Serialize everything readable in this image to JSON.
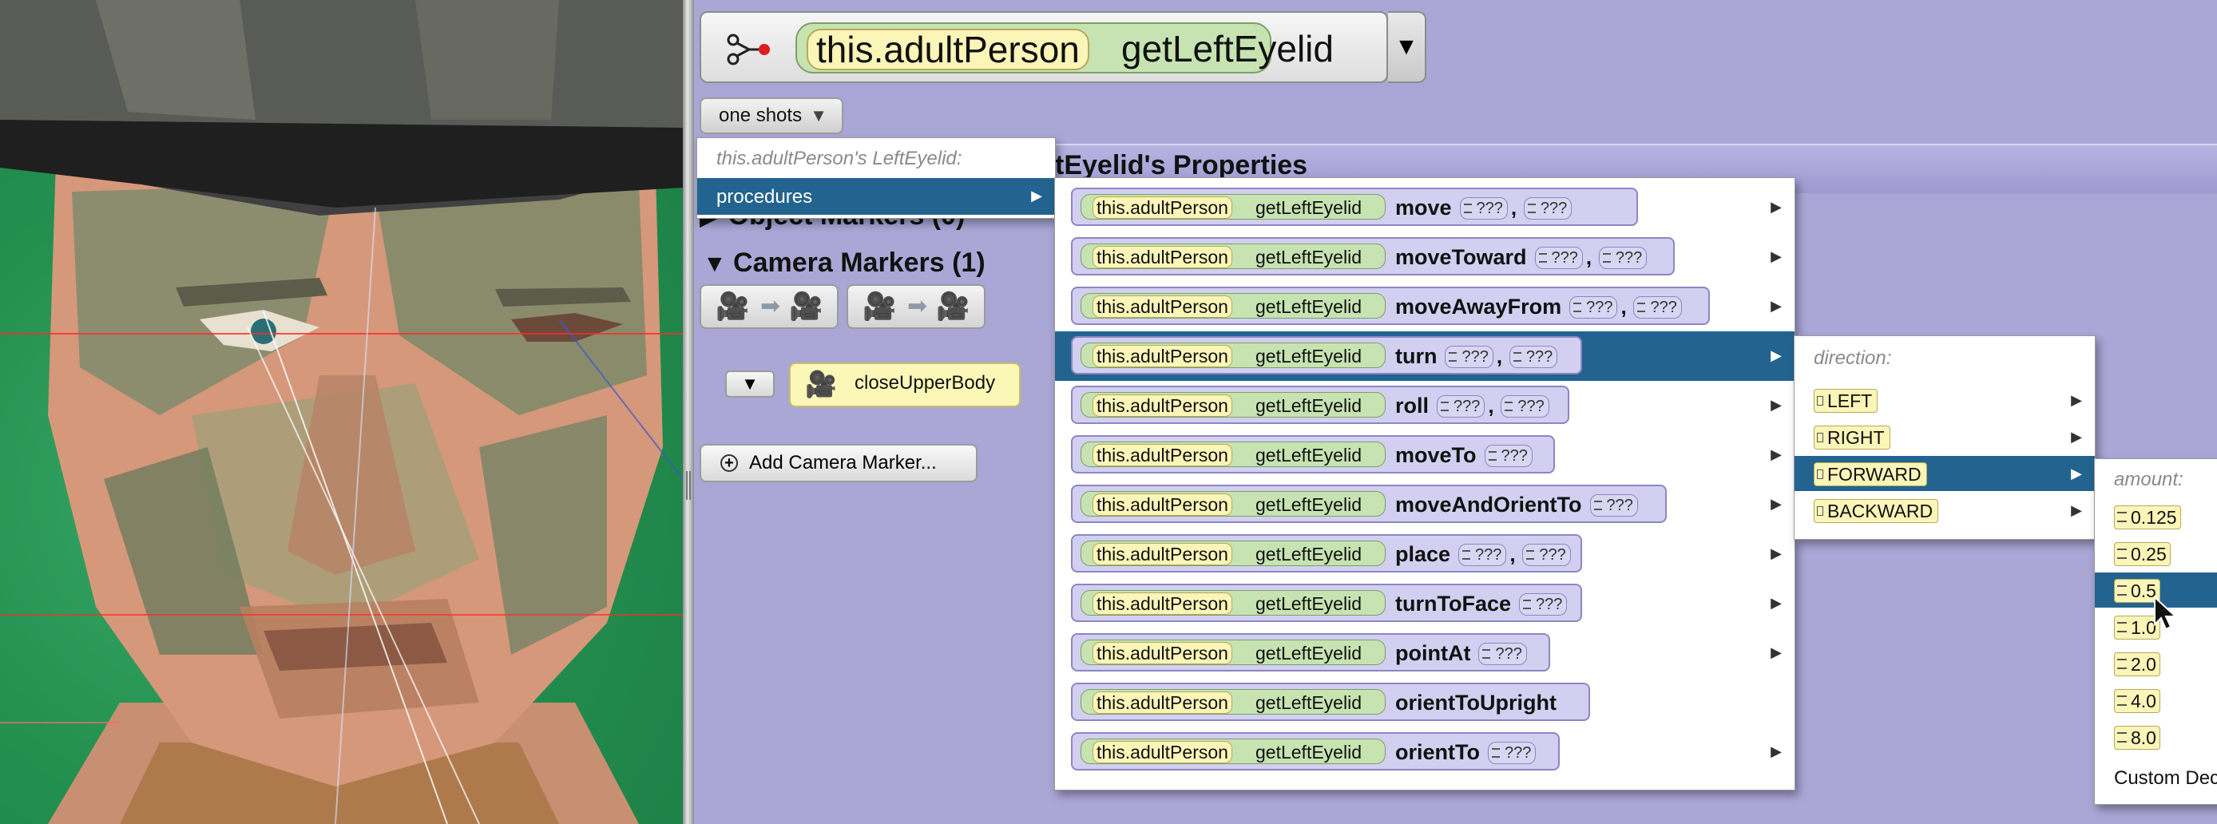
{
  "expression": {
    "target": "this.adultPerson",
    "method": "getLeftEyelid"
  },
  "toolbar": {
    "one_shots_label": "one shots",
    "dropdown_caret": "▼"
  },
  "panel": {
    "properties_heading": "LeftEyelid's Properties",
    "object_markers_heading": "Object Markers (0)",
    "camera_markers_heading": "Camera Markers (1)",
    "marker_name": "closeUpperBody",
    "add_marker_label": "Add Camera Marker..."
  },
  "menu_main": {
    "caption": "this.adultPerson's LeftEyelid:",
    "selected_item": "procedures"
  },
  "procedures": [
    {
      "name": "move",
      "args": [
        "???",
        "???"
      ]
    },
    {
      "name": "moveToward",
      "args": [
        "???",
        "???"
      ]
    },
    {
      "name": "moveAwayFrom",
      "args": [
        "???",
        "???"
      ]
    },
    {
      "name": "turn",
      "args": [
        "???",
        "???"
      ],
      "selected": true
    },
    {
      "name": "roll",
      "args": [
        "???",
        "???"
      ]
    },
    {
      "name": "moveTo",
      "args": [
        "???"
      ]
    },
    {
      "name": "moveAndOrientTo",
      "args": [
        "???"
      ]
    },
    {
      "name": "place",
      "args": [
        "???",
        "???"
      ]
    },
    {
      "name": "turnToFace",
      "args": [
        "???"
      ]
    },
    {
      "name": "pointAt",
      "args": [
        "???"
      ]
    },
    {
      "name": "orientToUpright",
      "args": []
    },
    {
      "name": "orientTo",
      "args": [
        "???"
      ]
    }
  ],
  "direction_menu": {
    "caption": "direction:",
    "items": [
      "LEFT",
      "RIGHT",
      "FORWARD",
      "BACKWARD"
    ],
    "selected": "FORWARD"
  },
  "amount_menu": {
    "caption": "amount:",
    "items": [
      "0.125",
      "0.25",
      "0.5",
      "1.0",
      "2.0",
      "4.0",
      "8.0"
    ],
    "selected": "0.5",
    "custom_label": "Custom Decimal Number..."
  },
  "colors": {
    "selection": "#22648f",
    "background": "#aaa6d6",
    "expression_green": "#c6e3b1",
    "object_yellow": "#fbf5b8",
    "procedure_purple": "#d2cff0"
  },
  "icons": [
    "function-icon",
    "camera-icon",
    "arrow-icon",
    "add-icon",
    "mouse-pointer-icon"
  ]
}
